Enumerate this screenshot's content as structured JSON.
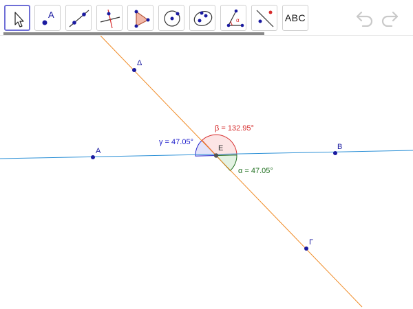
{
  "toolbar": {
    "tools": [
      {
        "name": "move-tool-button",
        "icon": "cursor-arrow-icon",
        "selected": true
      },
      {
        "name": "point-tool-button",
        "icon": "point-icon",
        "label": "A"
      },
      {
        "name": "line-tool-button",
        "icon": "line-through-points-icon"
      },
      {
        "name": "perpendicular-tool-button",
        "icon": "perpendicular-line-icon"
      },
      {
        "name": "polygon-tool-button",
        "icon": "polygon-icon"
      },
      {
        "name": "circle-tool-button",
        "icon": "circle-center-point-icon"
      },
      {
        "name": "conic-tool-button",
        "icon": "ellipse-icon"
      },
      {
        "name": "angle-tool-button",
        "icon": "angle-icon",
        "label": "α"
      },
      {
        "name": "reflect-tool-button",
        "icon": "reflect-about-line-icon"
      },
      {
        "name": "text-tool-button",
        "icon": "text-icon",
        "label": "ABC"
      }
    ],
    "undo_icon": "undo-icon",
    "redo_icon": "redo-icon"
  },
  "colors": {
    "line_ab": "#2a8fd6",
    "line_delta_gamma": "#f08a24",
    "point": "#1a1aa0",
    "angle_beta": "#d62a2a",
    "angle_gamma": "#2222cc",
    "angle_alpha": "#1f6f1f"
  },
  "construction": {
    "points": [
      {
        "id": "A",
        "label": "A"
      },
      {
        "id": "B",
        "label": "B"
      },
      {
        "id": "E",
        "label": "E"
      },
      {
        "id": "Delta",
        "label": "Δ"
      },
      {
        "id": "Gamma",
        "label": "Γ"
      }
    ],
    "angles": {
      "beta": "β = 132.95°",
      "gamma": "γ = 47.05°",
      "alpha": "α = 47.05°"
    }
  }
}
